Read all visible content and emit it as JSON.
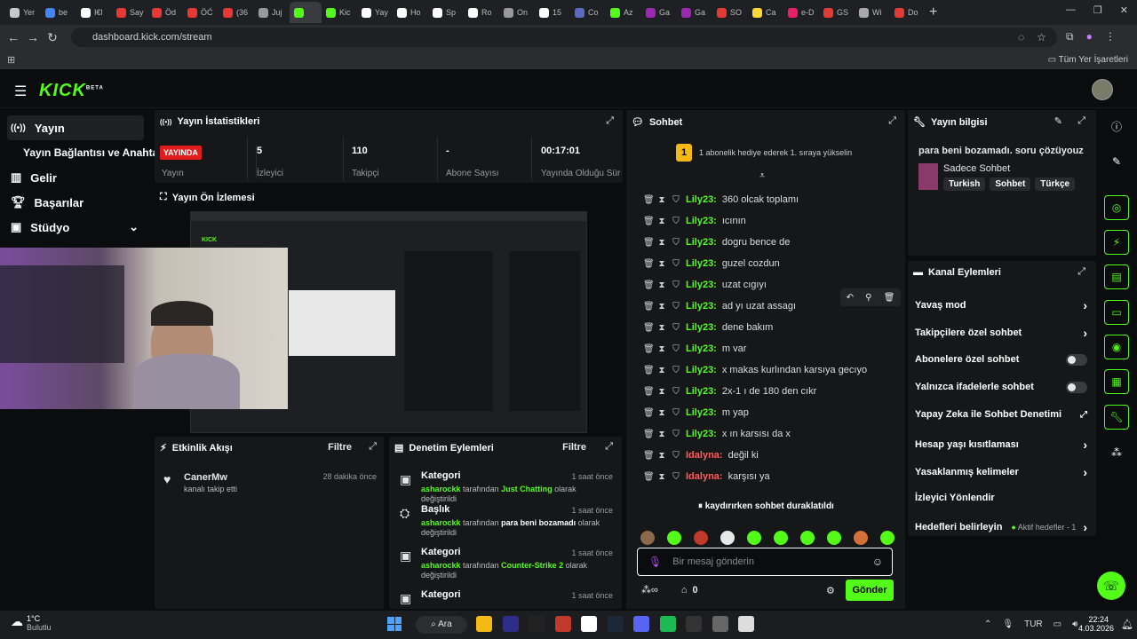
{
  "browser": {
    "tabs": [
      "Yer",
      "be",
      "I€l",
      "Say",
      "Öd",
      "ÖĆ",
      "(36",
      "Juj",
      "",
      "Kic",
      "Yay",
      "Ho",
      "Sp",
      "Ro",
      "On",
      "15",
      "Co",
      "Az",
      "Ga",
      "Ga",
      "SO",
      "Ca",
      "e-D",
      "GS",
      "Wi",
      "Do"
    ],
    "url": "dashboard.kick.com/stream",
    "bookmarks_label": "Tüm Yer İşaretleri",
    "colors": [
      "#c8c8c8",
      "#4285f4",
      "#fff",
      "#e53935",
      "#e53935",
      "#e53935",
      "#e53935",
      "#999",
      "#53fc18",
      "#53fc18",
      "#fff",
      "#fff",
      "#fff",
      "#fff",
      "#999",
      "#fff",
      "#5c6bc0",
      "#53fc18",
      "#9c27b0",
      "#9c27b0",
      "#e53935",
      "#fdd835",
      "#e91e63",
      "#e53935",
      "#aaa",
      "#e53935"
    ]
  },
  "header": {
    "logo": "KICK",
    "beta": "BETA"
  },
  "sidebar": {
    "items": [
      {
        "label": "Yayın",
        "icon": "broadcast-icon"
      },
      {
        "label": "Yayın Bağlantısı ve Anahtarı",
        "icon": "key-icon"
      },
      {
        "label": "Gelir",
        "icon": "chart-icon"
      },
      {
        "label": "Başarılar",
        "icon": "trophy-icon"
      },
      {
        "label": "Stüdyo",
        "icon": "studio-icon"
      }
    ]
  },
  "stats": {
    "title": "Yayın İstatistikleri",
    "live_badge": "YAYINDA",
    "live_label": "Yayın",
    "items": [
      {
        "value": "5",
        "label": "İzleyici"
      },
      {
        "value": "110",
        "label": "Takipçi"
      },
      {
        "value": "-",
        "label": "Abone Sayısı"
      },
      {
        "value": "00:17:01",
        "label": "Yayında Olduğu Süre"
      }
    ]
  },
  "preview": {
    "title": "Yayın Ön İzlemesi"
  },
  "activity": {
    "title": "Etkinlik Akışı",
    "filter": "Filtre",
    "items": [
      {
        "user": "CanerMw",
        "time": "28 dakika önce",
        "text": "kanalı takip etti"
      }
    ]
  },
  "moderation": {
    "title": "Denetim Eylemleri",
    "filter": "Filtre",
    "items": [
      {
        "kind": "Kategori",
        "time": "1 saat önce",
        "user": "asharockk",
        "pre": "tarafından",
        "value": "Just Chatting",
        "post": "olarak değiştirildi"
      },
      {
        "kind": "Başlık",
        "time": "1 saat önce",
        "user": "asharockk",
        "pre": "tarafından",
        "value": "para beni bozamadı",
        "post": "olarak değiştirildi"
      },
      {
        "kind": "Kategori",
        "time": "1 saat önce",
        "user": "asharockk",
        "pre": "tarafından",
        "value": "Counter-Strike 2",
        "post": "olarak değiştirildi"
      },
      {
        "kind": "Kategori",
        "time": "1 saat önce"
      }
    ]
  },
  "chat": {
    "title": "Sohbet",
    "banner": "1 abonelik hediye ederek 1. sıraya yükselin",
    "lines": [
      {
        "user": "Lily23:",
        "msg": "360 olcak toplamı"
      },
      {
        "user": "Lily23:",
        "msg": "ıcının"
      },
      {
        "user": "Lily23:",
        "msg": "dogru bence de"
      },
      {
        "user": "Lily23:",
        "msg": "guzel cozdun"
      },
      {
        "user": "Lily23:",
        "msg": "uzat cıgıyı"
      },
      {
        "user": "Lily23:",
        "msg": "ad yı uzat assagı"
      },
      {
        "user": "Lily23:",
        "msg": "dene bakım"
      },
      {
        "user": "Lily23:",
        "msg": "m var"
      },
      {
        "user": "Lily23:",
        "msg": "x makas kurlından karsıya gecıyo"
      },
      {
        "user": "Lily23:",
        "msg": "2x-1 ı de 180 den cıkr"
      },
      {
        "user": "Lily23:",
        "msg": "m yap"
      },
      {
        "user": "Lily23:",
        "msg": "x ın karsısı da x"
      },
      {
        "user": "Idalyna:",
        "msg": "değil ki"
      },
      {
        "user": "Idalyna:",
        "msg": "karşısı ya"
      }
    ],
    "paused": "kaydırırken sohbet duraklatıldı",
    "placeholder": "Bir mesaj gönderin",
    "send": "Gönder",
    "count": "0"
  },
  "info": {
    "title": "Yayın bilgisi",
    "stream_title": "para beni bozamadı. soru çözüyouz",
    "category": "Sadece Sohbet",
    "tags": [
      "Turkish",
      "Sohbet",
      "Türkçe"
    ]
  },
  "channel": {
    "title": "Kanal Eylemleri",
    "actions": [
      {
        "label": "Yavaş mod",
        "control": "arrow"
      },
      {
        "label": "Takipçilere özel sohbet",
        "control": "arrow"
      },
      {
        "label": "Abonelere özel sohbet",
        "control": "toggle"
      },
      {
        "label": "Yalnızca ifadelerle sohbet",
        "control": "toggle"
      },
      {
        "label": "Yapay Zeka ile Sohbet Denetimi",
        "control": "external"
      },
      {
        "label": "Hesap yaşı kısıtlaması",
        "control": "arrow"
      },
      {
        "label": "Yasaklanmış kelimeler",
        "control": "arrow"
      },
      {
        "label": "İzleyici Yönlendir",
        "control": "none"
      },
      {
        "label": "Hedefleri belirleyin",
        "control": "arrow",
        "extra": "Aktif hedefler - 1"
      }
    ]
  },
  "taskbar": {
    "weather_temp": "1°C",
    "weather_desc": "Bulutlu",
    "search": "Ara",
    "lang": "TUR",
    "time": "22:24",
    "date": "4.03.2026"
  }
}
